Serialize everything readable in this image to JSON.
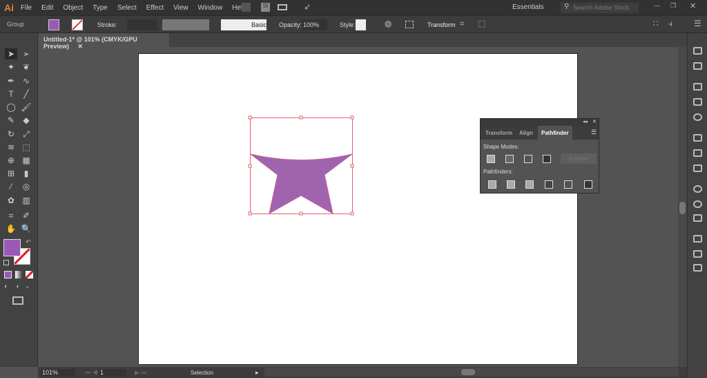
{
  "app": {
    "logo": "Ai"
  },
  "menu": [
    "File",
    "Edit",
    "Object",
    "Type",
    "Select",
    "Effect",
    "View",
    "Window",
    "Help"
  ],
  "workspace": "Essentials",
  "search_placeholder": "Search Adobe Stock",
  "control": {
    "selection": "Group",
    "stroke_label": "Stroke:",
    "brush": "Basic",
    "opacity_label": "Opacity:",
    "opacity": "100%",
    "style_label": "Style:",
    "transform": "Transform"
  },
  "document_tab": "Untitled-1* @ 101% (CMYK/GPU Preview)",
  "pathfinder": {
    "tabs": [
      "Transform",
      "Align",
      "Pathfinder"
    ],
    "shape_modes": "Shape Modes:",
    "expand": "Expand",
    "pathfinders": "Pathfinders:"
  },
  "status": {
    "zoom": "101%",
    "page": "1",
    "tool": "Selection"
  },
  "colors": {
    "fill": "#9b59b6",
    "shape": "#a064ae",
    "selection": "#e0606e"
  }
}
